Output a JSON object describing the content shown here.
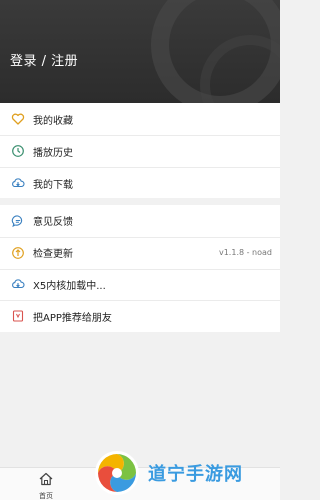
{
  "header": {
    "login_label": "登录 / 注册"
  },
  "menu_top": [
    {
      "label": "我的收藏",
      "icon": "heart-icon"
    },
    {
      "label": "播放历史",
      "icon": "clock-icon"
    },
    {
      "label": "我的下载",
      "icon": "cloud-download-icon"
    }
  ],
  "menu_bottom": [
    {
      "label": "意见反馈",
      "icon": "chat-icon"
    },
    {
      "label": "检查更新",
      "icon": "update-icon",
      "value": "v1.1.8 - noad"
    },
    {
      "label": "X5内核加载中...",
      "icon": "cloud-download-icon"
    },
    {
      "label": "把APP推荐给朋友",
      "icon": "bookmark-icon"
    }
  ],
  "tabbar": {
    "home_label": "首页"
  },
  "watermark": {
    "text": "道宁手游网"
  },
  "colors": {
    "header_bg": "#2f2f2f",
    "icon_stroke": "#555555",
    "heart_accent": "#e0a020",
    "update_accent": "#e0a020",
    "bookmark_accent": "#d9534f",
    "watermark_blue": "#3a9be0"
  }
}
